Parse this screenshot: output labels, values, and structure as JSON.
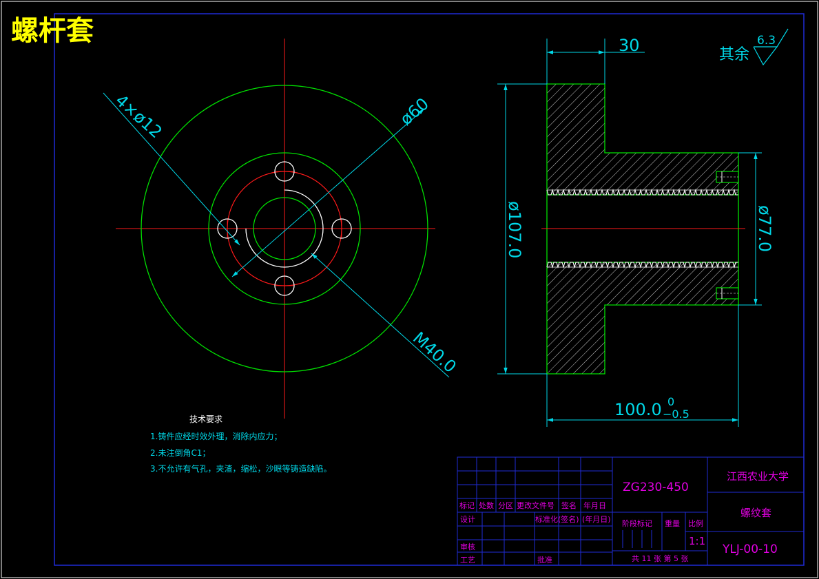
{
  "title": "螺杆套",
  "front_view": {
    "dim_holes": "4×ø12",
    "dim_pcd": "ø60",
    "dim_thread": "M40.0"
  },
  "section_view": {
    "dim_width": "30",
    "dim_od": "ø107.0",
    "dim_hub": "ø77.0",
    "dim_length": "100.0",
    "tol_upper": "0",
    "tol_lower": "−0.5"
  },
  "roughness": {
    "label": "其余",
    "value": "6.3"
  },
  "tech_req": {
    "heading": "技术要求",
    "items": [
      "1.铸件应经时效外理，消除内应力；",
      "2.未注倒角C1；",
      "3.不允许有气孔，夹渣，缩松，沙眼等铸造缺陷。"
    ]
  },
  "title_block": {
    "material": "ZG230-450",
    "school": "江西农业大学",
    "part_name": "螺纹套",
    "drawing_no": "YLJ-00-10",
    "row_headers": [
      "标记",
      "处数",
      "分区",
      "更改文件号",
      "签名",
      "年月日"
    ],
    "design": "设计",
    "standardize": "标准化",
    "sign": "(签名)",
    "date": "(年月日)",
    "review": "审核",
    "process": "工艺",
    "approve": "批准",
    "stage_mark": "阶段标记",
    "weight": "重量",
    "scale_label": "比例",
    "scale": "1:1",
    "sheets": "共 11 张 第 5 张"
  },
  "colors": {
    "frame": "#1f2bd6",
    "green": "#00e000",
    "red": "#ff1a1a",
    "cyan": "#00d8e8",
    "white": "#ffffff",
    "yellow": "#ffff00",
    "magenta": "#e000e0"
  }
}
